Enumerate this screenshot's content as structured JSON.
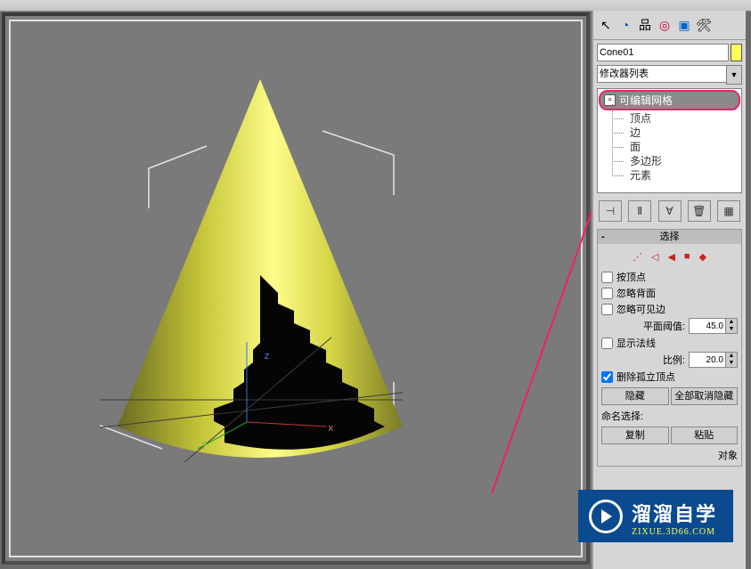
{
  "object_name": "Cone01",
  "modifier_dropdown": "修改器列表",
  "mod_stack": {
    "root": "可编辑网格",
    "sub": [
      "顶点",
      "边",
      "面",
      "多边形",
      "元素"
    ]
  },
  "rollout_selection": {
    "title": "选择",
    "by_vertex": "按顶点",
    "ignore_backfacing": "忽略背面",
    "ignore_visible_edges": "忽略可见边",
    "planar_thresh_label": "平面阈值:",
    "planar_thresh_value": "45.0",
    "show_normals": "显示法线",
    "scale_label": "比例:",
    "scale_value": "20.0",
    "delete_isolated": "删除孤立顶点",
    "hide_btn": "隐藏",
    "unhide_btn": "全部取消隐藏",
    "named_sel_label": "命名选择:",
    "copy_btn": "复制",
    "paste_btn": "粘贴",
    "object_suffix": "对象"
  },
  "axes": {
    "x": "x",
    "y": "y",
    "z": "z"
  },
  "watermark": {
    "big": "溜溜自学",
    "small": "ZIXUE.3D66.COM"
  }
}
